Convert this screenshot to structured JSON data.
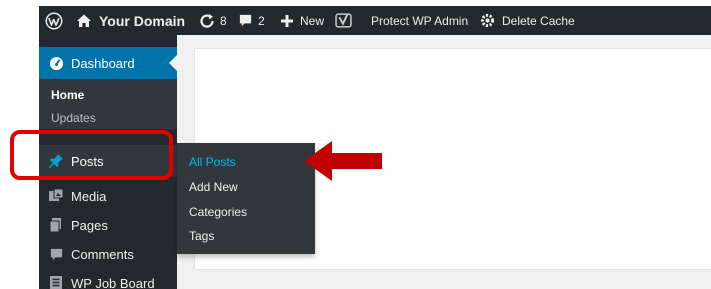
{
  "admin_bar": {
    "site_name": "Your Domain",
    "updates_count": "8",
    "comments_count": "2",
    "new_label": "New",
    "protect_label": "Protect WP Admin",
    "cache_label": "Delete Cache"
  },
  "sidebar": {
    "dashboard_label": "Dashboard",
    "dashboard_submenu": [
      "Home",
      "Updates"
    ],
    "items": [
      {
        "label": "Posts"
      },
      {
        "label": "Media"
      },
      {
        "label": "Pages"
      },
      {
        "label": "Comments"
      },
      {
        "label": "WP Job Board"
      }
    ]
  },
  "posts_flyout": {
    "items": [
      "All Posts",
      "Add New",
      "Categories",
      "Tags"
    ]
  },
  "colors": {
    "admin_bar_bg": "#23282d",
    "sidebar_bg": "#23282d",
    "submenu_bg": "#32373c",
    "accent": "#0073aa",
    "active_link": "#00b9eb",
    "annotation_red": "#e40000"
  }
}
